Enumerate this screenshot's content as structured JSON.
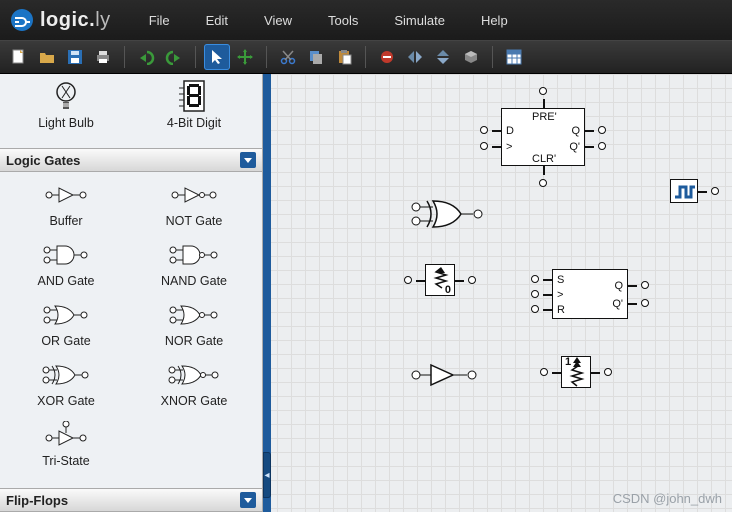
{
  "app": {
    "brand_main": "logic.",
    "brand_suffix": "ly"
  },
  "menus": [
    "File",
    "Edit",
    "View",
    "Tools",
    "Simulate",
    "Help"
  ],
  "sidebar": {
    "seg_output": {
      "items": [
        {
          "label": "Light Bulb"
        },
        {
          "label": "4-Bit Digit"
        }
      ]
    },
    "cat_logic_label": "Logic Gates",
    "seg_logic": {
      "items": [
        {
          "label": "Buffer"
        },
        {
          "label": "NOT Gate"
        },
        {
          "label": "AND Gate"
        },
        {
          "label": "NAND Gate"
        },
        {
          "label": "OR Gate"
        },
        {
          "label": "NOR Gate"
        },
        {
          "label": "XOR Gate"
        },
        {
          "label": "XNOR Gate"
        },
        {
          "label": "Tri-State"
        }
      ]
    },
    "cat_ff_label": "Flip-Flops"
  },
  "canvas": {
    "dff": {
      "pre": "PRE'",
      "d": "D",
      "clr": "CLR'",
      "q": "Q",
      "qn": "Q'"
    },
    "srff": {
      "s": "S",
      "r": "R",
      "q": "Q",
      "qn": "Q'"
    },
    "pd0": "0",
    "pu1": "1"
  },
  "watermark": "CSDN @john_dwh"
}
